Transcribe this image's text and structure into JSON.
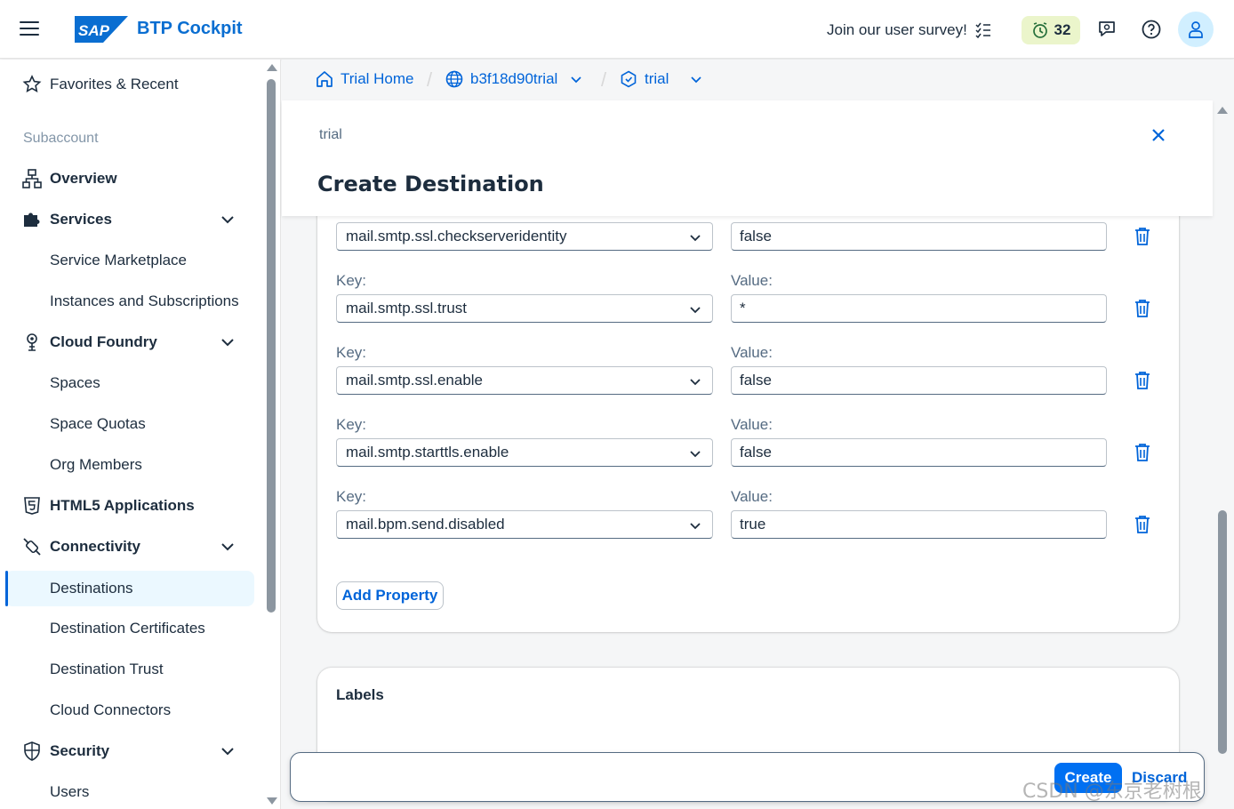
{
  "shell": {
    "product_name": "BTP Cockpit",
    "logo_text": "SAP",
    "survey_text": "Join our user survey!",
    "notification_count": "32"
  },
  "sidebar": {
    "favorites": "Favorites & Recent",
    "group_subaccount": "Subaccount",
    "items": {
      "overview": "Overview",
      "services": "Services",
      "service_marketplace": "Service Marketplace",
      "instances": "Instances and Subscriptions",
      "cloud_foundry": "Cloud Foundry",
      "spaces": "Spaces",
      "space_quotas": "Space Quotas",
      "org_members": "Org Members",
      "html5": "HTML5 Applications",
      "connectivity": "Connectivity",
      "destinations": "Destinations",
      "dest_certs": "Destination Certificates",
      "dest_trust": "Destination Trust",
      "cloud_connectors": "Cloud Connectors",
      "security": "Security",
      "users": "Users"
    }
  },
  "breadcrumb": {
    "home": "Trial Home",
    "account": "b3f18d90trial",
    "subaccount": "trial"
  },
  "dialog": {
    "subtitle": "trial",
    "title": "Create Destination"
  },
  "properties": {
    "key_label": "Key:",
    "value_label": "Value:",
    "rows": [
      {
        "key": "mail.smtp.ssl.checkserveridentity",
        "value": "false"
      },
      {
        "key": "mail.smtp.ssl.trust",
        "value": "*"
      },
      {
        "key": "mail.smtp.ssl.enable",
        "value": "false"
      },
      {
        "key": "mail.smtp.starttls.enable",
        "value": "false"
      },
      {
        "key": "mail.bpm.send.disabled",
        "value": "true"
      }
    ],
    "add_label": "Add Property"
  },
  "labels_section": {
    "title": "Labels"
  },
  "footer": {
    "create_label": "Create",
    "discard_label": "Discard"
  },
  "watermark": "CSDN @东京老树根",
  "colors": {
    "brand_blue": "#0064d9",
    "button_blue": "#0070f2",
    "text": "#1d2d3e",
    "notification_bg": "#ebf5cb",
    "avatar_bg": "#d1efff"
  }
}
